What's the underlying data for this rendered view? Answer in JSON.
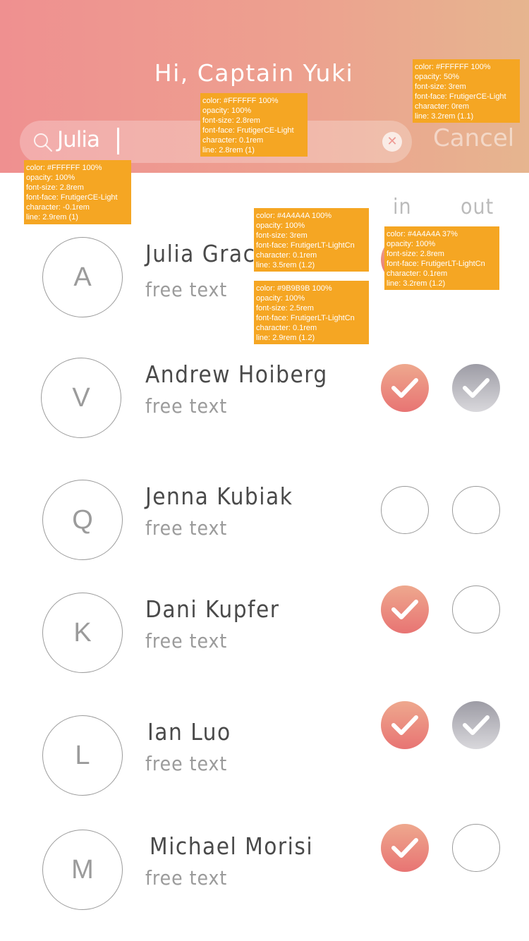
{
  "header": {
    "greeting": "Hi, Captain Yuki",
    "search": {
      "value": "Julia",
      "cancel_label": "Cancel"
    }
  },
  "columns": {
    "in_label": "in",
    "out_label": "out"
  },
  "contacts": [
    {
      "initial": "A",
      "name": "Julia Grace",
      "subtitle": "free text",
      "in": "checked",
      "out": "hidden"
    },
    {
      "initial": "V",
      "name": "Andrew Hoiberg",
      "subtitle": "free text",
      "in": "checked",
      "out": "checked"
    },
    {
      "initial": "Q",
      "name": "Jenna Kubiak",
      "subtitle": "free text",
      "in": "unchecked",
      "out": "unchecked"
    },
    {
      "initial": "K",
      "name": "Dani Kupfer",
      "subtitle": "free text",
      "in": "checked",
      "out": "unchecked"
    },
    {
      "initial": "L",
      "name": "Ian Luo",
      "subtitle": "free text",
      "in": "checked",
      "out": "checked"
    },
    {
      "initial": "M",
      "name": "Michael Morisi",
      "subtitle": "free text",
      "in": "checked",
      "out": "unchecked"
    }
  ],
  "annotations": [
    {
      "lines": [
        "color: #FFFFFF 100%",
        "opacity: 50%",
        "font-size: 3rem",
        "font-face: FrutigerCE-Light",
        "character: 0rem",
        "line: 3.2rem (1.1)"
      ]
    },
    {
      "lines": [
        "color: #FFFFFF 100%",
        "opacity: 100%",
        "font-size: 2.8rem",
        "font-face: FrutigerCE-Light",
        "character: 0.1rem",
        "line: 2.8rem (1)"
      ]
    },
    {
      "lines": [
        "color: #FFFFFF 100%",
        "opacity: 100%",
        "font-size: 2.8rem",
        "font-face: FrutigerCE-Light",
        "character: -0.1rem",
        "line: 2.9rem (1)"
      ]
    },
    {
      "lines": [
        "color: #4A4A4A 100%",
        "opacity: 100%",
        "font-size: 3rem",
        "font-face: FrutigerLT-LightCn",
        "character: 0.1rem",
        "line: 3.5rem (1.2)"
      ]
    },
    {
      "lines": [
        "color: #4A4A4A 37%",
        "opacity: 100%",
        "font-size: 2.8rem",
        "font-face: FrutigerLT-LightCn",
        "character: 0.1rem",
        "line: 3.2rem (1.2)"
      ]
    },
    {
      "lines": [
        "color: #9B9B9B 100%",
        "opacity: 100%",
        "font-size: 2.5rem",
        "font-face: FrutigerLT-LightCn",
        "character: 0.1rem",
        "line: 2.9rem (1.2)"
      ]
    }
  ]
}
